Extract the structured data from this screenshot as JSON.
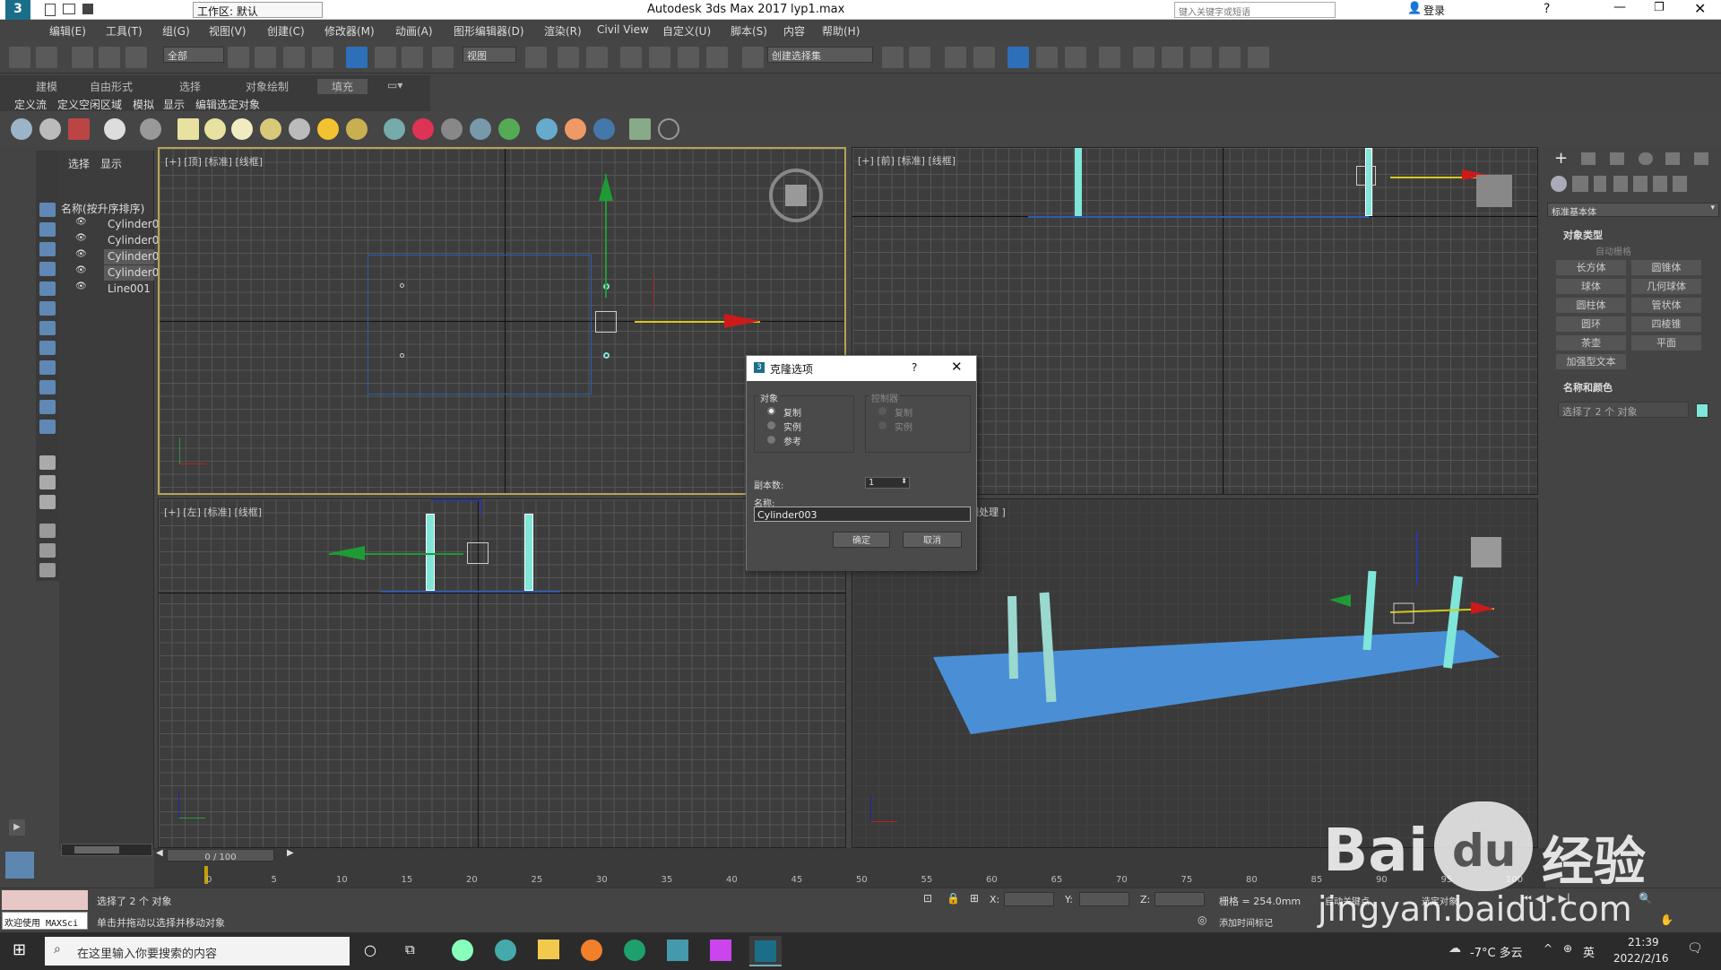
{
  "app": {
    "title": "Autodesk 3ds Max 2017",
    "file": "lyp1.max",
    "workspace_label": "工作区: 默认",
    "search_placeholder": "键入关键字或短语",
    "login_label": "登录"
  },
  "menu": [
    "编辑(E)",
    "工具(T)",
    "组(G)",
    "视图(V)",
    "创建(C)",
    "修改器(M)",
    "动画(A)",
    "图形编辑器(D)",
    "渲染(R)",
    "Civil View",
    "自定义(U)",
    "脚本(S)",
    "内容",
    "帮助(H)"
  ],
  "toolbar": {
    "filter_label": "全部",
    "view_label": "视图",
    "selection_set_label": "创建选择集"
  },
  "ribbon": {
    "tabs": [
      "建模",
      "自由形式",
      "选择",
      "对象绘制",
      "填充"
    ],
    "subtabs": [
      "定义流",
      "定义空闲区域",
      "模拟",
      "显示",
      "编辑选定对象"
    ]
  },
  "scene_explorer": {
    "tabs": [
      "选择",
      "显示"
    ],
    "header": "名称(按升序排序)",
    "items": [
      "Cylinder0",
      "Cylinder0",
      "Cylinder0",
      "Cylinder0",
      "Line001"
    ]
  },
  "viewports": {
    "top_label": "[+] [顶] [标准] [线框]",
    "front_label": "[+] [前] [标准] [线框]",
    "left_label": "[+] [左] [标准] [线框]",
    "persp_label": "细处理 ]"
  },
  "command_panel": {
    "dropdown_label": "标准基本体",
    "section1_title": "对象类型",
    "autogrid_label": "自动栅格",
    "buttons": [
      "长方体",
      "圆锥体",
      "球体",
      "几何球体",
      "圆柱体",
      "管状体",
      "圆环",
      "四棱锥",
      "茶壶",
      "平面",
      "加强型文本"
    ],
    "section2_title": "名称和颜色",
    "name_value": "选择了 2 个 对象",
    "object_color": "#7fe6d9"
  },
  "clone_dialog": {
    "title": "克隆选项",
    "help": "?",
    "object_group": "对象",
    "object_options": [
      "复制",
      "实例",
      "参考"
    ],
    "controller_group": "控制器",
    "controller_options": [
      "复制",
      "实例"
    ],
    "copies_label": "副本数:",
    "copies_value": "1",
    "name_label": "名称:",
    "name_value": "Cylinder003",
    "ok_label": "确定",
    "cancel_label": "取消"
  },
  "timeline": {
    "position": "0 / 100",
    "ticks": [
      "0",
      "5",
      "10",
      "15",
      "20",
      "25",
      "30",
      "35",
      "40",
      "45",
      "50",
      "55",
      "60",
      "65",
      "70",
      "75",
      "80",
      "85",
      "90",
      "95",
      "100"
    ]
  },
  "status": {
    "maxscript_label": "欢迎使用 MAXSci",
    "selected_text": "选择了 2 个 对象",
    "hint_text": "单击并拖动以选择并移动对象",
    "x_label": "X:",
    "y_label": "Y:",
    "z_label": "Z:",
    "grid_text": "栅格 = 254.0mm",
    "add_time_tag": "添加时间标记",
    "auto_key": "自动关键点",
    "set_key": "选定对象"
  },
  "taskbar": {
    "search_placeholder": "在这里输入你要搜索的内容",
    "weather": "-7°C 多云",
    "ime": "英",
    "time": "21:39",
    "date": "2022/2/16"
  },
  "watermark": {
    "brand": "Bai",
    "brand2": "du",
    "suffix": "经验",
    "url": "jingyan.baidu.com"
  }
}
